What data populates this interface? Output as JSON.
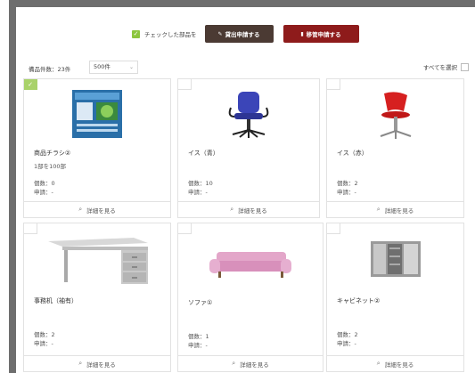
{
  "actionbar": {
    "checked_label": "チェックした部品を",
    "loan_button": "貸出申請する",
    "transfer_button": "移管申請する",
    "loan_icon": "edit-icon",
    "transfer_icon": "file-icon"
  },
  "toolbar": {
    "count_text": "備品件数：23件",
    "per_page": "500件",
    "select_all": "すべてを選択"
  },
  "cards": [
    {
      "name": "商品チラシ②",
      "sub": "1部を100部",
      "count": "個数：0",
      "status": "申請：-",
      "detail": "詳細を見る",
      "image": "flyer",
      "checked": true
    },
    {
      "name": "イス（青）",
      "sub": "",
      "count": "個数：10",
      "status": "申請：-",
      "detail": "詳細を見る",
      "image": "chair-blue",
      "checked": false
    },
    {
      "name": "イス（赤）",
      "sub": "",
      "count": "個数：2",
      "status": "申請：-",
      "detail": "詳細を見る",
      "image": "chair-red",
      "checked": false
    },
    {
      "name": "事務机（袖有）",
      "sub": "",
      "count": "個数：2",
      "status": "申請：-",
      "detail": "詳細を見る",
      "image": "desk",
      "checked": false
    },
    {
      "name": "ソファ①",
      "sub": "",
      "count": "個数：1",
      "status": "申請：-",
      "detail": "詳細を見る",
      "image": "sofa",
      "checked": false
    },
    {
      "name": "キャビネット②",
      "sub": "",
      "count": "個数：2",
      "status": "申請：-",
      "detail": "詳細を見る",
      "image": "cabinet",
      "checked": false
    }
  ],
  "colors": {
    "check_green": "#8dc63f",
    "btn_dark": "#4b3a33",
    "btn_red": "#8e1b1b"
  }
}
